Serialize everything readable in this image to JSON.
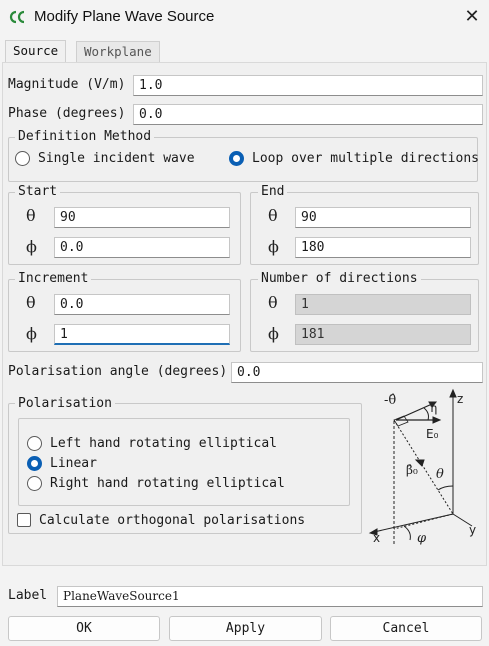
{
  "window": {
    "title": "Modify Plane Wave Source"
  },
  "tabs": [
    {
      "label": "Source"
    },
    {
      "label": "Workplane"
    }
  ],
  "magnitude": {
    "label": "Magnitude (V/m)",
    "value": "1.0"
  },
  "phase": {
    "label": "Phase (degrees)",
    "value": "0.0"
  },
  "definition": {
    "title": "Definition Method",
    "single": "Single incident wave",
    "loop": "Loop over multiple directions",
    "selected": "loop"
  },
  "start": {
    "title": "Start",
    "theta_symbol": "θ",
    "phi_symbol": "ϕ",
    "theta": "90",
    "phi": "0.0"
  },
  "end": {
    "title": "End",
    "theta_symbol": "θ",
    "phi_symbol": "ϕ",
    "theta": "90",
    "phi": "180"
  },
  "increment": {
    "title": "Increment",
    "theta_symbol": "θ",
    "phi_symbol": "ϕ",
    "theta": "0.0",
    "phi": "1"
  },
  "num_directions": {
    "title": "Number of directions",
    "theta_symbol": "θ",
    "phi_symbol": "ϕ",
    "theta": "1",
    "phi": "181"
  },
  "polarisation_angle": {
    "label": "Polarisation angle (degrees)",
    "value": "0.0"
  },
  "polarisation": {
    "title": "Polarisation",
    "options": [
      {
        "label": "Left hand rotating elliptical",
        "selected": false
      },
      {
        "label": "Linear",
        "selected": true
      },
      {
        "label": "Right hand rotating elliptical",
        "selected": false
      }
    ],
    "orthogonal_label": "Calculate orthogonal polarisations",
    "orthogonal_checked": false
  },
  "diagram": {
    "neg_theta": "-θ̂",
    "eta": "η",
    "z": "z",
    "e0": "E₀",
    "beta0": "β̂₀",
    "theta": "θ",
    "x": "x",
    "phi": "φ",
    "y": "y"
  },
  "label_field": {
    "label": "Label",
    "value": "PlaneWaveSource1"
  },
  "buttons": {
    "ok": "OK",
    "apply": "Apply",
    "cancel": "Cancel"
  },
  "colors": {
    "accent": "#0a5fb4",
    "focus_underline": "#1f6fb5",
    "readonly_bg": "#d5d5d5"
  }
}
